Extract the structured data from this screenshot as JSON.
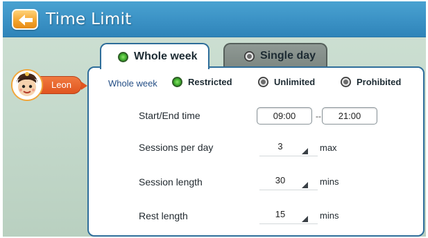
{
  "header": {
    "title": "Time Limit",
    "back_icon": "back-arrow-icon"
  },
  "tabs": [
    {
      "label": "Whole week",
      "selected": true
    },
    {
      "label": "Single day",
      "selected": false
    }
  ],
  "profile": {
    "name": "Leon"
  },
  "mode": {
    "label": "Whole week",
    "options": [
      {
        "label": "Restricted",
        "selected": true
      },
      {
        "label": "Unlimited",
        "selected": false
      },
      {
        "label": "Prohibited",
        "selected": false
      }
    ]
  },
  "schedule": {
    "start_end_label": "Start/End time",
    "start": "09:00",
    "separator": "--",
    "end": "21:00",
    "sessions_label": "Sessions per day",
    "sessions_value": "3",
    "sessions_unit": "max",
    "session_length_label": "Session length",
    "session_length_value": "30",
    "session_length_unit": "mins",
    "rest_label": "Rest length",
    "rest_value": "15",
    "rest_unit": "mins"
  },
  "colors": {
    "header": "#3c93c6",
    "accent_orange": "#f3a32c",
    "name_pill": "#e0551f",
    "border_blue": "#2e6d9a",
    "radio_on": "#3fae2d"
  }
}
